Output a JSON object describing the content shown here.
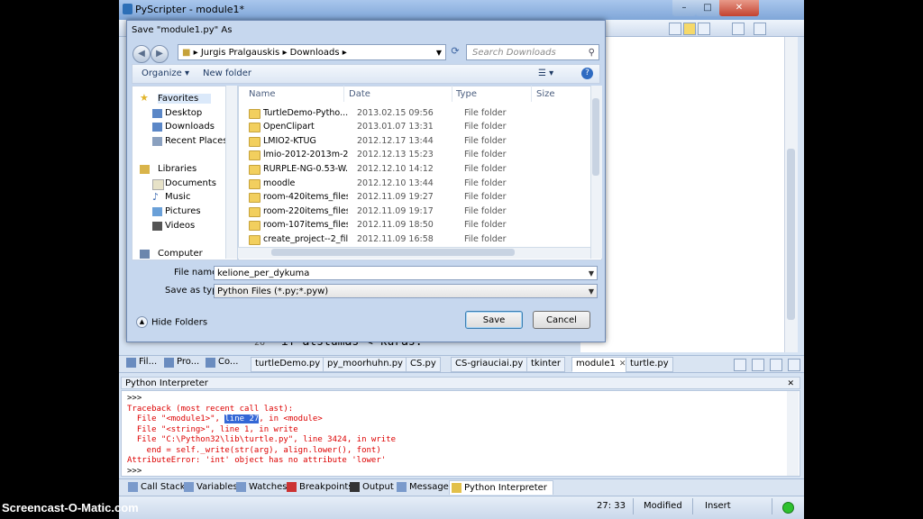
{
  "app": {
    "title": "PyScripter - module1*",
    "window_controls": {
      "minimize": "–",
      "maximize": "□",
      "close": "✕"
    },
    "editor_line": {
      "line_number": "26",
      "code": "if atstumas < kuras:"
    }
  },
  "side_tabs": [
    "Fil...",
    "Pro...",
    "Co..."
  ],
  "file_tabs": [
    {
      "label": "turtleDemo.py",
      "active": false
    },
    {
      "label": "py_moorhuhn.py",
      "active": false
    },
    {
      "label": "CS.py",
      "active": false
    },
    {
      "label": "CS-griauciai.py",
      "active": false
    },
    {
      "label": "tkinter",
      "active": false
    },
    {
      "label": "module1",
      "active": true
    },
    {
      "label": "turtle.py",
      "active": false
    }
  ],
  "interpreter": {
    "title": "Python Interpreter",
    "close": "✕",
    "prompt1": ">>>",
    "traceback": "Traceback (most recent call last):",
    "frame1_pre": "  File \"<module1>\", ",
    "frame1_hl": "line 27",
    "frame1_post": ", in <module>",
    "frame2": "  File \"<string>\", line 1, in write",
    "frame3": "  File \"C:\\Python32\\lib\\turtle.py\", line 3424, in write",
    "frame3_code": "    end = self._write(str(arg), align.lower(), font)",
    "error": "AttributeError: 'int' object has no attribute 'lower'",
    "prompt2": ">>>"
  },
  "bottom_tabs": [
    "Call Stack",
    "Variables",
    "Watches",
    "Breakpoints",
    "Output",
    "Messages",
    "Python Interpreter"
  ],
  "status": {
    "position": "27: 33",
    "modified": "Modified",
    "mode": "Insert"
  },
  "dialog": {
    "title": "Save \"module1.py\" As",
    "address": [
      "Jurgis Pralgauskis",
      "Downloads"
    ],
    "search_placeholder": "Search Downloads",
    "toolbar": {
      "organize": "Organize ▾",
      "new_folder": "New folder"
    },
    "nav": {
      "favorites": "Favorites",
      "desktop": "Desktop",
      "downloads": "Downloads",
      "recent_places": "Recent Places",
      "libraries": "Libraries",
      "documents": "Documents",
      "music": "Music",
      "pictures": "Pictures",
      "videos": "Videos",
      "computer": "Computer"
    },
    "columns": {
      "name": "Name",
      "date": "Date",
      "type": "Type",
      "size": "Size"
    },
    "files": [
      {
        "name": "TurtleDemo-Pytho...",
        "date": "2013.02.15 09:56",
        "type": "File folder"
      },
      {
        "name": "OpenClipart",
        "date": "2013.01.07 13:31",
        "type": "File folder"
      },
      {
        "name": "LMIO2-KTUG",
        "date": "2012.12.17 13:44",
        "type": "File folder"
      },
      {
        "name": "lmio-2012-2013m-2...",
        "date": "2012.12.13 15:23",
        "type": "File folder"
      },
      {
        "name": "RURPLE-NG-0.53-W...",
        "date": "2012.12.10 14:12",
        "type": "File folder"
      },
      {
        "name": "moodle",
        "date": "2012.12.10 13:44",
        "type": "File folder"
      },
      {
        "name": "room-420items_files",
        "date": "2012.11.09 19:27",
        "type": "File folder"
      },
      {
        "name": "room-220items_files",
        "date": "2012.11.09 19:17",
        "type": "File folder"
      },
      {
        "name": "room-107items_files",
        "date": "2012.11.09 18:50",
        "type": "File folder"
      },
      {
        "name": "create_project--2_fil...",
        "date": "2012.11.09 16:58",
        "type": "File folder"
      }
    ],
    "file_name_label": "File name:",
    "file_name_value": "kelione_per_dykuma",
    "save_type_label": "Save as type:",
    "save_type_value": "Python Files (*.py;*.pyw)",
    "hide_folders": "Hide Folders",
    "save": "Save",
    "cancel": "Cancel"
  },
  "watermark": "Screencast-O-Matic.com"
}
